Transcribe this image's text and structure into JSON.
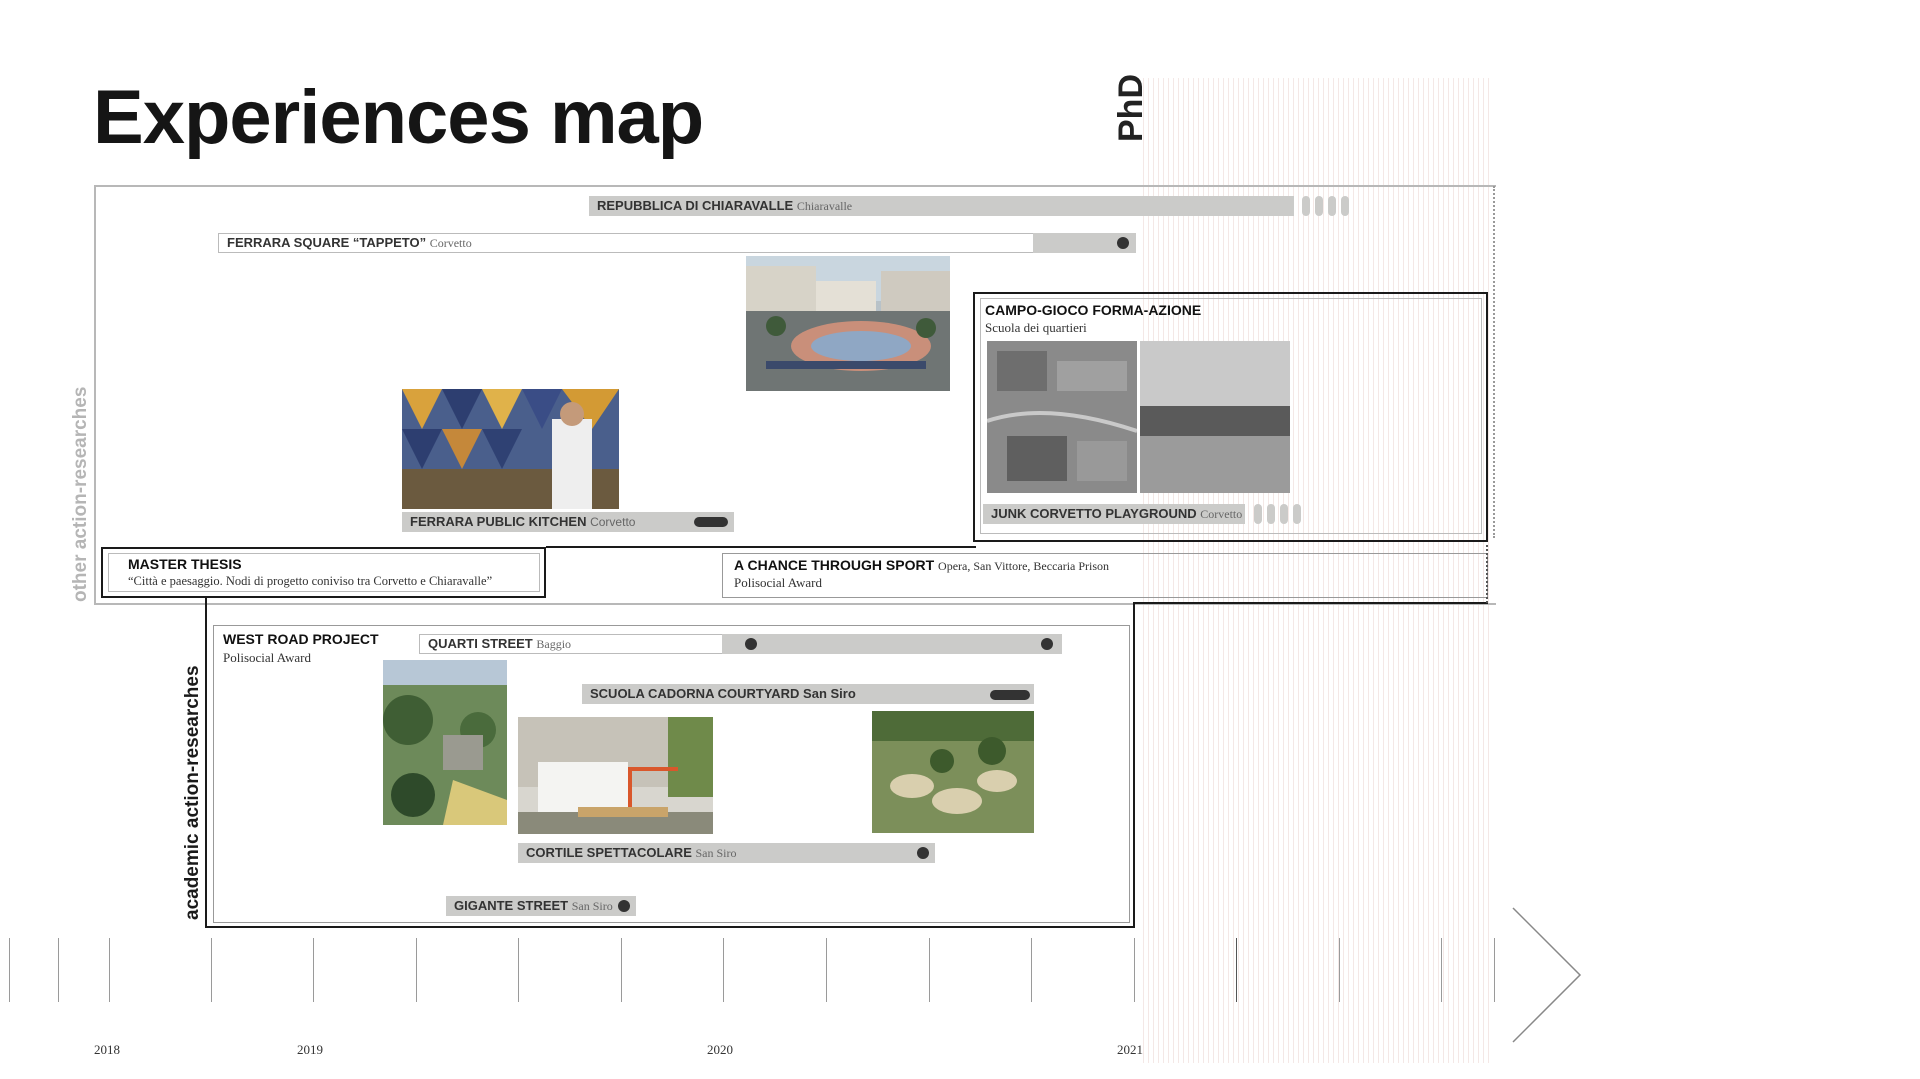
{
  "title": "Experiences map",
  "phd_label": "PhD",
  "axis_labels": {
    "other": "other action-researches",
    "academic": "academic action-researches"
  },
  "years": [
    "2018",
    "2019",
    "2020",
    "2021"
  ],
  "projects": {
    "repubblica": {
      "name": "REPUBBLICA DI CHIARAVALLE",
      "location": "Chiaravalle"
    },
    "ferrara_square": {
      "name": "FERRARA SQUARE “TAPPETO”",
      "location": "Corvetto"
    },
    "campo_gioco": {
      "name": "CAMPO-GIOCO FORMA-AZIONE",
      "subtitle": "Scuola dei quartieri"
    },
    "junk": {
      "name": "JUNK CORVETTO PLAYGROUND",
      "location": "Corvetto"
    },
    "ferrara_kitchen": {
      "name": "FERRARA PUBLIC KITCHEN",
      "location": "Corvetto"
    },
    "master_thesis": {
      "name": "MASTER THESIS",
      "subtitle": "“Città e paesaggio. Nodi di progetto coniviso tra Corvetto e Chiaravalle”"
    },
    "chance_sport": {
      "name": "A CHANCE THROUGH SPORT",
      "location": "Opera, San Vittore, Beccaria Prison",
      "subtitle": "Polisocial Award"
    },
    "west_road": {
      "name": "WEST ROAD PROJECT",
      "subtitle": "Polisocial Award"
    },
    "quarti": {
      "name": "QUARTI STREET",
      "location": "Baggio"
    },
    "cadorna": {
      "name": "SCUOLA CADORNA COURTYARD San Siro"
    },
    "cortile": {
      "name": "CORTILE SPETTACOLARE",
      "location": "San Siro"
    },
    "gigante": {
      "name": "GIGANTE STREET",
      "location": "San Siro"
    }
  },
  "colors": {
    "bar": "#cbcbc9",
    "accent_dark": "#1a1a1a",
    "phd_band": "#cd968c"
  }
}
